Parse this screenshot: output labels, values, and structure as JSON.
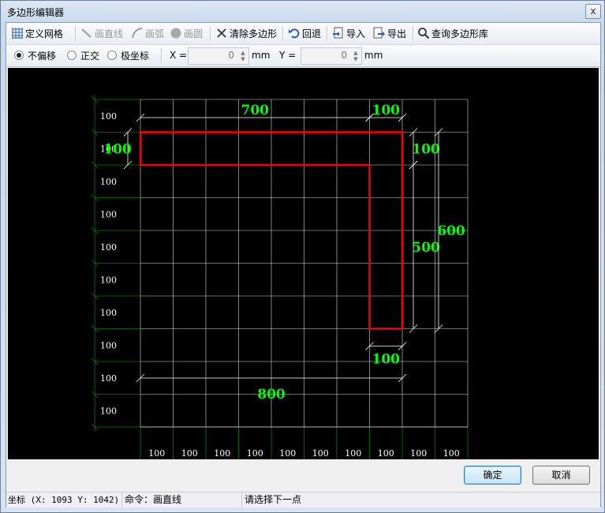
{
  "window": {
    "title": "多边形编辑器",
    "close_glyph": "x"
  },
  "toolbar": {
    "define_grid": "定义网格",
    "draw_line": "画直线",
    "draw_arc": "画弧",
    "draw_circle": "画圆",
    "clear_polygon": "清除多边形",
    "undo": "回退",
    "import": "导入",
    "export": "导出",
    "query_library": "查询多边形库"
  },
  "options": {
    "mode_none": "不偏移",
    "mode_ortho": "正交",
    "mode_polar": "极坐标",
    "selected_mode": "不偏移",
    "x_label": "X =",
    "x_value": "0",
    "x_unit": "mm",
    "y_label": "Y =",
    "y_value": "0",
    "y_unit": "mm"
  },
  "canvas": {
    "grid_colors": {
      "grid": "#ffffff",
      "axis": "#008000",
      "polygon": "#ff0000",
      "dimension": "#00ff00"
    },
    "row_labels": [
      "100",
      "100",
      "100",
      "100",
      "100",
      "100",
      "100",
      "100",
      "100",
      "100"
    ],
    "col_labels": [
      "100",
      "100",
      "100",
      "100",
      "100",
      "100",
      "100",
      "100",
      "100",
      "100"
    ],
    "dimensions": {
      "top_width": "700",
      "top_right_width": "100",
      "left_height": "100",
      "right_top_height": "100",
      "right_lower_height": "500",
      "right_total_height": "600",
      "bottom_leg_width": "100",
      "total_width": "800"
    }
  },
  "buttons": {
    "ok": "确定",
    "cancel": "取消"
  },
  "status": {
    "coords": "坐标 (X: 1093 Y: 1042)",
    "command": "命令：画直线",
    "prompt": "请选择下一点"
  }
}
